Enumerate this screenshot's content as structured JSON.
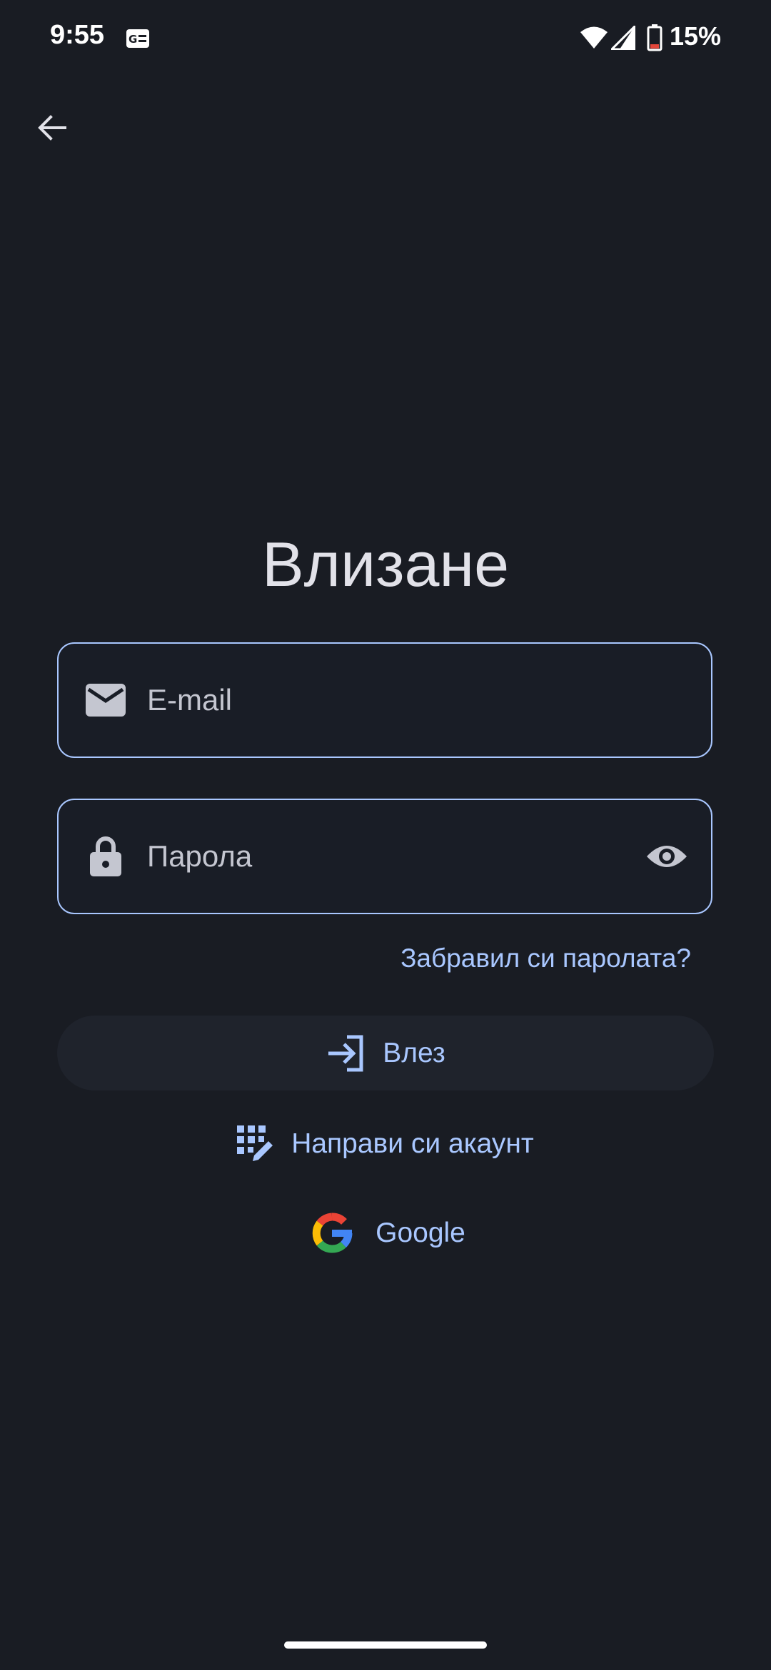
{
  "status_bar": {
    "time": "9:55",
    "battery": "15%",
    "icons": [
      "notification-icon",
      "wifi-icon",
      "signal-icon",
      "battery-icon"
    ]
  },
  "header": {
    "back_icon": "arrow-left-icon"
  },
  "login": {
    "title": "Влизане",
    "email": {
      "placeholder": "E-mail",
      "value": "",
      "icon": "mail-icon"
    },
    "password": {
      "placeholder": "Парола",
      "value": "",
      "icon": "lock-icon",
      "toggle_icon": "eye-icon"
    },
    "forgot_password": "Забравил си паролата?",
    "login_button": {
      "label": "Влез",
      "icon": "login-icon"
    },
    "create_account": {
      "label": "Направи си акаунт",
      "icon": "app-registration-icon"
    },
    "google": {
      "label": "Google",
      "icon": "google-logo-icon"
    }
  },
  "colors": {
    "background": "#191c23",
    "accent": "#a9c7ff",
    "field_border": "#a9c7ff",
    "text_primary": "#e2e2e9",
    "text_secondary": "#c4c6d0",
    "button_surface": "#1f232c"
  }
}
